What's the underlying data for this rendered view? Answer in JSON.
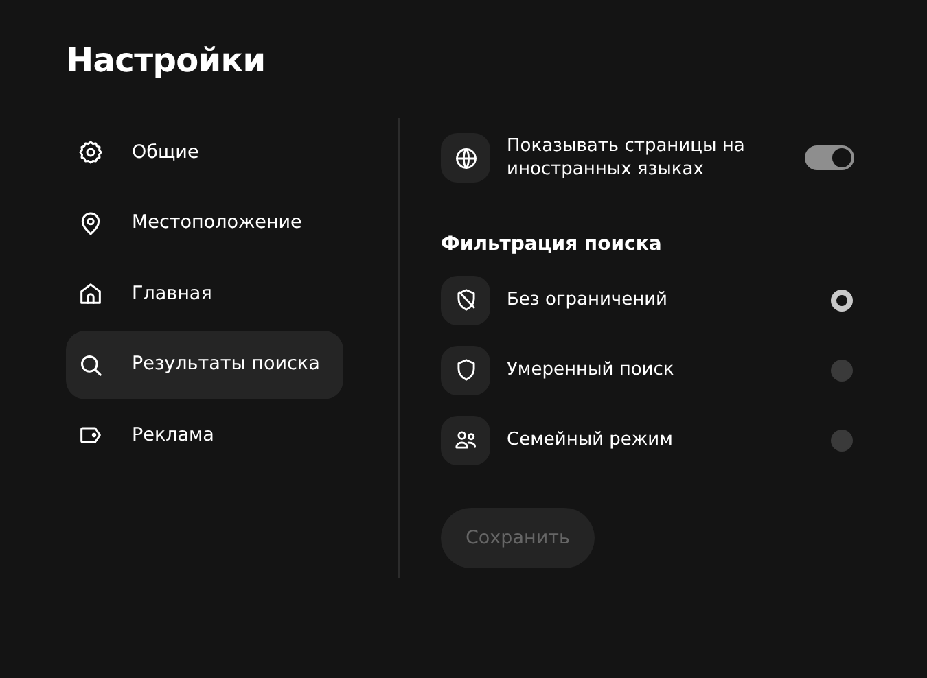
{
  "title": "Настройки",
  "sidebar": {
    "items": [
      {
        "label": "Общие",
        "selected": false
      },
      {
        "label": "Местоположение",
        "selected": false
      },
      {
        "label": "Главная",
        "selected": false
      },
      {
        "label": "Результаты поиска",
        "selected": true
      },
      {
        "label": "Реклама",
        "selected": false
      }
    ]
  },
  "foreign_pages": {
    "label": "Показывать страницы на иностранных языках",
    "on": true
  },
  "filter": {
    "heading": "Фильтрация поиска",
    "options": [
      {
        "label": "Без ограничений",
        "selected": true
      },
      {
        "label": "Умеренный поиск",
        "selected": false
      },
      {
        "label": "Семейный режим",
        "selected": false
      }
    ]
  },
  "save_button": {
    "label": "Сохранить",
    "disabled": true
  }
}
